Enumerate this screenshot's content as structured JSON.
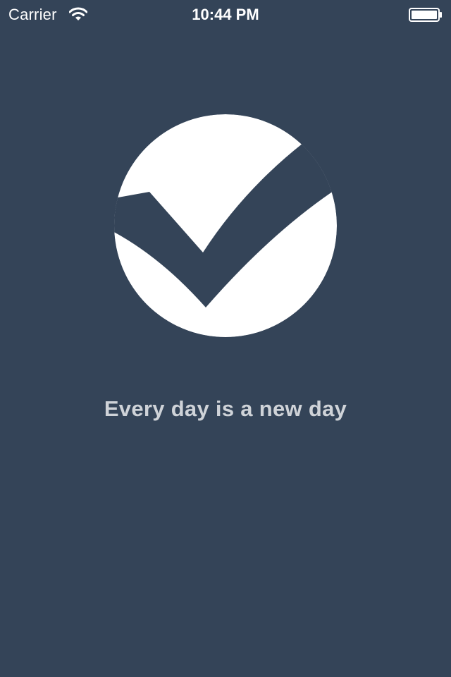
{
  "status_bar": {
    "carrier": "Carrier",
    "time": "10:44 PM",
    "wifi_icon": "wifi-icon",
    "battery_icon": "battery-icon"
  },
  "splash": {
    "logo_icon": "checkmark-circle-logo",
    "tagline": "Every day is a new day"
  },
  "colors": {
    "background": "#344458",
    "logo": "#ffffff",
    "tagline": "#cfd3d8",
    "status_text": "#ffffff"
  }
}
